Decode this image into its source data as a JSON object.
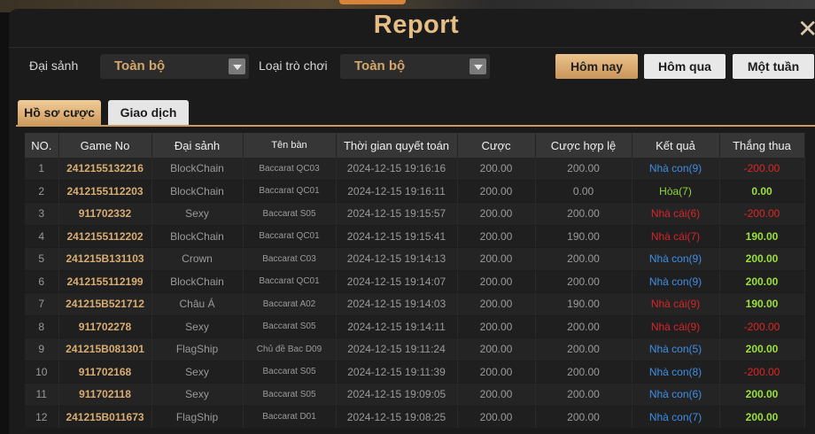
{
  "title": "Report",
  "filters": {
    "hall_label": "Đại sảnh",
    "hall_value": "Toàn bộ",
    "game_type_label": "Loại trò chơi",
    "game_type_value": "Toàn bộ"
  },
  "date_buttons": [
    "Hôm nay",
    "Hôm qua",
    "Một tuần"
  ],
  "tabs": [
    "Hồ sơ cược",
    "Giao dịch"
  ],
  "table": {
    "headers": [
      "NO.",
      "Game No",
      "Đại sảnh",
      "Tên bàn",
      "Thời gian quyết toán",
      "Cược",
      "Cược hợp lệ",
      "Kết quả",
      "Thắng thua"
    ],
    "rows": [
      [
        "1",
        "2412155132216",
        "BlockChain",
        "Baccarat QC03",
        "2024-12-15 19:16:16",
        "200.00",
        "200.00",
        "Nhà con(9)",
        "-200.00"
      ],
      [
        "2",
        "2412155112203",
        "BlockChain",
        "Baccarat QC01",
        "2024-12-15 19:16:11",
        "200.00",
        "0.00",
        "Hòa(7)",
        "0.00"
      ],
      [
        "3",
        "911702332",
        "Sexy",
        "Baccarat S05",
        "2024-12-15 19:15:57",
        "200.00",
        "200.00",
        "Nhà cái(6)",
        "-200.00"
      ],
      [
        "4",
        "2412155112202",
        "BlockChain",
        "Baccarat QC01",
        "2024-12-15 19:15:41",
        "200.00",
        "190.00",
        "Nhà cái(7)",
        "190.00"
      ],
      [
        "5",
        "241215B131103",
        "Crown",
        "Baccarat C03",
        "2024-12-15 19:14:13",
        "200.00",
        "200.00",
        "Nhà con(9)",
        "200.00"
      ],
      [
        "6",
        "2412155112199",
        "BlockChain",
        "Baccarat QC01",
        "2024-12-15 19:14:07",
        "200.00",
        "200.00",
        "Nhà con(9)",
        "200.00"
      ],
      [
        "7",
        "241215B521712",
        "Châu Á",
        "Baccarat A02",
        "2024-12-15 19:14:03",
        "200.00",
        "190.00",
        "Nhà cái(9)",
        "190.00"
      ],
      [
        "8",
        "911702278",
        "Sexy",
        "Baccarat S05",
        "2024-12-15 19:14:11",
        "200.00",
        "200.00",
        "Nhà cái(9)",
        "-200.00"
      ],
      [
        "9",
        "241215B081301",
        "FlagShip",
        "Chủ đề Bac D09",
        "2024-12-15 19:11:24",
        "200.00",
        "200.00",
        "Nhà con(5)",
        "200.00"
      ],
      [
        "10",
        "911702168",
        "Sexy",
        "Baccarat S05",
        "2024-12-15 19:11:39",
        "200.00",
        "200.00",
        "Nhà con(8)",
        "-200.00"
      ],
      [
        "11",
        "911702118",
        "Sexy",
        "Baccarat S05",
        "2024-12-15 19:09:05",
        "200.00",
        "200.00",
        "Nhà con(6)",
        "200.00"
      ],
      [
        "12",
        "241215B011673",
        "FlagShip",
        "Baccarat D01",
        "2024-12-15 19:08:25",
        "200.00",
        "200.00",
        "Nhà con(7)",
        "200.00"
      ]
    ],
    "result_colors": [
      "blue",
      "green",
      "red",
      "red",
      "blue",
      "blue",
      "red",
      "red",
      "blue",
      "blue",
      "blue",
      "blue"
    ]
  },
  "colors": {
    "accent": "#d4a66a",
    "blue_result": "#3f8ee8",
    "red_result": "#d8242b",
    "green_result": "#8ed83a",
    "negative": "#e02626",
    "positive": "#9be03b"
  },
  "icons": {
    "close": "close-icon",
    "dropdown": "chevron-down-icon"
  }
}
